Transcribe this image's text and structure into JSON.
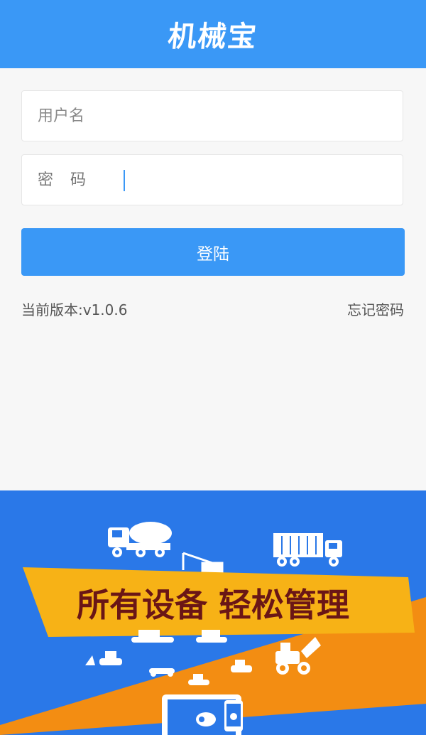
{
  "header": {
    "title": "机械宝"
  },
  "login": {
    "username_placeholder": "用户名",
    "password_label": "密码",
    "submit_label": "登陆"
  },
  "footer": {
    "version": "当前版本:v1.0.6",
    "forgot_password": "忘记密码"
  },
  "banner": {
    "slogan": "所有设备 轻松管理",
    "icons": [
      "concrete-mixer-truck-icon",
      "crane-icon",
      "container-truck-icon",
      "excavator-icon",
      "bulldozer-icon",
      "wheel-loader-icon",
      "laptop-icon",
      "phone-icon"
    ]
  },
  "colors": {
    "primary": "#3a98f6",
    "banner_bg": "#2a78e8",
    "banner_stripe": "#f7b216",
    "banner_orange": "#f38d12",
    "slogan_text": "#6a1616"
  }
}
